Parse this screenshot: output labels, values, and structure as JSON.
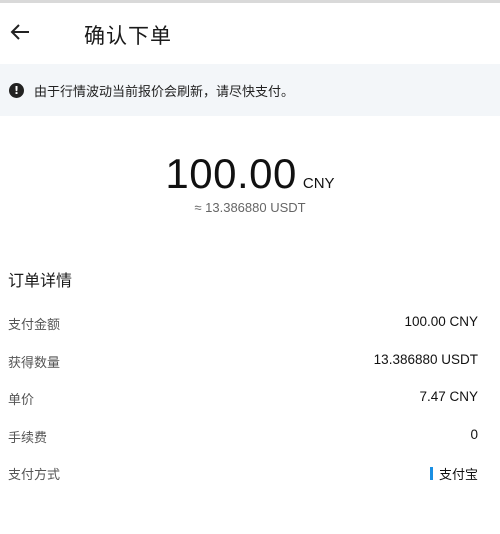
{
  "header": {
    "title": "确认下单",
    "back_icon": "arrow-left-icon"
  },
  "notice": {
    "icon": "info-filled-icon",
    "icon_glyph": "!",
    "text": "由于行情波动当前报价会刷新，请尽快支付。"
  },
  "amount": {
    "value": "100.00",
    "unit": "CNY",
    "equivalent": "≈ 13.386880 USDT"
  },
  "details": {
    "title": "订单详情",
    "rows": [
      {
        "label": "支付金额",
        "value": "100.00 CNY"
      },
      {
        "label": "获得数量",
        "value": "13.386880 USDT"
      },
      {
        "label": "单价",
        "value": "7.47 CNY"
      },
      {
        "label": "手续费",
        "value": "0"
      },
      {
        "label": "支付方式",
        "value": "支付宝",
        "icon": "alipay-mark"
      }
    ]
  },
  "colors": {
    "notice_bg": "#f3f6f9",
    "alipay_blue": "#1a8fe3"
  }
}
